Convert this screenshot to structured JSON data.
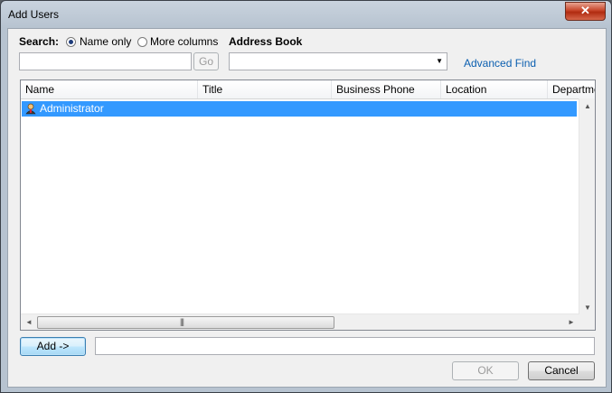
{
  "window": {
    "title": "Add Users",
    "close_glyph": "✕"
  },
  "search": {
    "label": "Search:",
    "options": [
      "Name only",
      "More columns"
    ],
    "selected": "Name only",
    "input_value": "",
    "go_label": "Go"
  },
  "address_book": {
    "label": "Address Book",
    "selected_value": "",
    "dropdown_glyph": "▼"
  },
  "advanced_find": "Advanced Find",
  "list": {
    "columns": [
      "Name",
      "Title",
      "Business Phone",
      "Location",
      "Departme"
    ],
    "rows": [
      {
        "name": "Administrator",
        "icon": "user-icon",
        "selected": true
      }
    ]
  },
  "scroll": {
    "up": "▲",
    "down": "▼",
    "left": "◄",
    "right": "►",
    "grip": "|||"
  },
  "add": {
    "label": "Add ->",
    "value": ""
  },
  "footer": {
    "ok": "OK",
    "cancel": "Cancel"
  },
  "colors": {
    "selection": "#3399ff",
    "link": "#0b5fb0"
  }
}
